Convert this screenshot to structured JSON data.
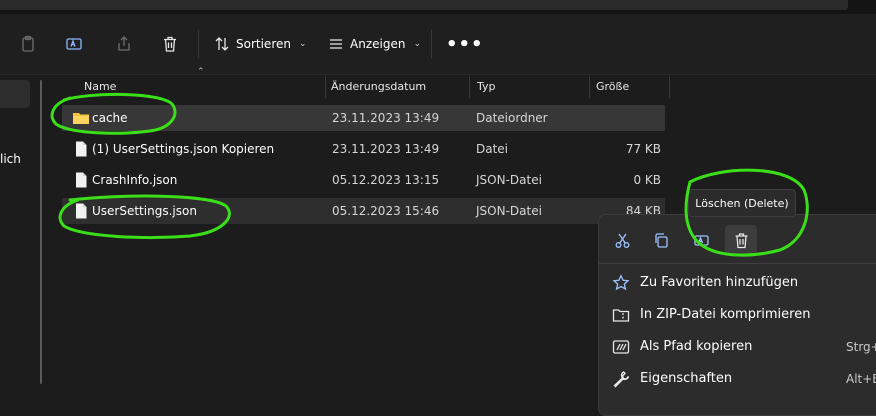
{
  "toolbar": {
    "sort_label": "Sortieren",
    "view_label": "Anzeigen",
    "more_label": "•••"
  },
  "sidebar": {
    "partial_text": "lich"
  },
  "columns": {
    "name": "Name",
    "date": "Änderungsdatum",
    "type": "Typ",
    "size": "Größe"
  },
  "files": [
    {
      "name": "cache",
      "date": "23.11.2023 13:49",
      "type": "Dateiordner",
      "size": "",
      "icon": "folder-icon"
    },
    {
      "name": "(1) UserSettings.json Kopieren",
      "date": "23.11.2023 13:49",
      "type": "Datei",
      "size": "77 KB",
      "icon": "file-icon"
    },
    {
      "name": "CrashInfo.json",
      "date": "05.12.2023 13:15",
      "type": "JSON-Datei",
      "size": "0 KB",
      "icon": "file-icon"
    },
    {
      "name": "UserSettings.json",
      "date": "05.12.2023 15:46",
      "type": "JSON-Datei",
      "size": "84 KB",
      "icon": "file-icon"
    }
  ],
  "tooltip": {
    "text": "Löschen (Delete)"
  },
  "context_menu": {
    "items": [
      {
        "label": "Zu Favoriten hinzufügen",
        "shortcut": "",
        "icon": "star-icon"
      },
      {
        "label": "In ZIP-Datei komprimieren",
        "shortcut": "",
        "icon": "zip-folder-icon"
      },
      {
        "label": "Als Pfad kopieren",
        "shortcut": "Strg+",
        "icon": "copy-path-icon"
      },
      {
        "label": "Eigenschaften",
        "shortcut": "Alt+E",
        "icon": "wrench-icon"
      }
    ]
  },
  "colors": {
    "annotation": "#3adf1a",
    "folder": "#f5c542",
    "background": "#1c1c1c",
    "selection": "#373737"
  }
}
